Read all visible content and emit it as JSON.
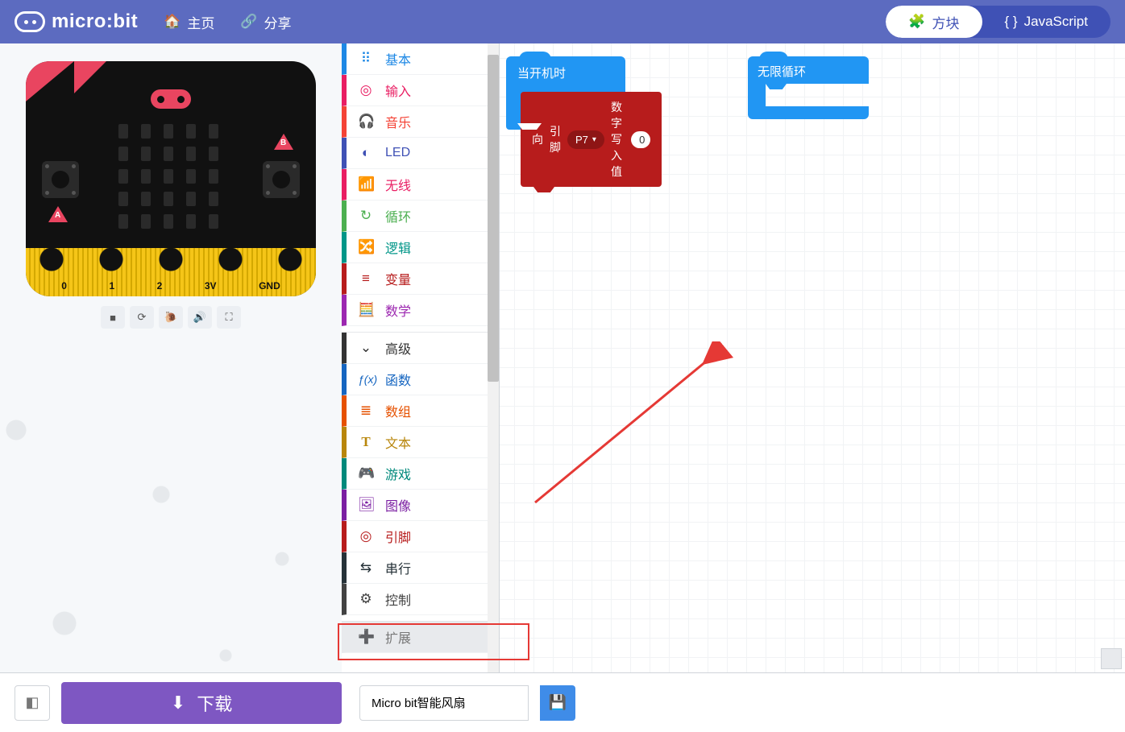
{
  "header": {
    "brand": "micro:bit",
    "home": "主页",
    "share": "分享",
    "blocks": "方块",
    "javascript": "JavaScript"
  },
  "simulator": {
    "pins": [
      "0",
      "1",
      "2",
      "3V",
      "GND"
    ],
    "btnA": "A",
    "btnB": "B"
  },
  "toolbox": {
    "basic": {
      "label": "基本",
      "color": "#1E88E5",
      "icon": "⠿"
    },
    "input": {
      "label": "输入",
      "color": "#E91E63",
      "icon": "◎"
    },
    "music": {
      "label": "音乐",
      "color": "#F44336",
      "icon": "🎧"
    },
    "led": {
      "label": "LED",
      "color": "#3F51B5",
      "icon": "◐"
    },
    "radio": {
      "label": "无线",
      "color": "#E91E63",
      "icon": "📶"
    },
    "loops": {
      "label": "循环",
      "color": "#4CAF50",
      "icon": "↻"
    },
    "logic": {
      "label": "逻辑",
      "color": "#009688",
      "icon": "🔀"
    },
    "vars": {
      "label": "变量",
      "color": "#B71C1C",
      "icon": "≡"
    },
    "math": {
      "label": "数学",
      "color": "#9C27B0",
      "icon": "🧮"
    },
    "advanced": {
      "label": "高级",
      "color": "#333333",
      "icon": "⌄"
    },
    "func": {
      "label": "函数",
      "color": "#1565C0",
      "icon": "ƒ(x)"
    },
    "array": {
      "label": "数组",
      "color": "#E65100",
      "icon": "≣"
    },
    "text": {
      "label": "文本",
      "color": "#B8860B",
      "icon": "T"
    },
    "game": {
      "label": "游戏",
      "color": "#00897B",
      "icon": "🎮"
    },
    "image": {
      "label": "图像",
      "color": "#7B1FA2",
      "icon": "🖼"
    },
    "pins": {
      "label": "引脚",
      "color": "#B71C1C",
      "icon": "◎"
    },
    "serial": {
      "label": "串行",
      "color": "#263238",
      "icon": "⇆"
    },
    "control": {
      "label": "控制",
      "color": "#424242",
      "icon": "⚙"
    },
    "ext": {
      "label": "扩展",
      "color": "#888888",
      "icon": "➕"
    }
  },
  "blocks": {
    "onStart": "当开机时",
    "forever": "无限循环",
    "pin": {
      "prefix1": "向",
      "prefix2": "引脚",
      "pinSel": "P7",
      "prefix3": "数字写入值",
      "value": "0"
    }
  },
  "footer": {
    "download": "下载",
    "projectName": "Micro bit智能风扇"
  }
}
